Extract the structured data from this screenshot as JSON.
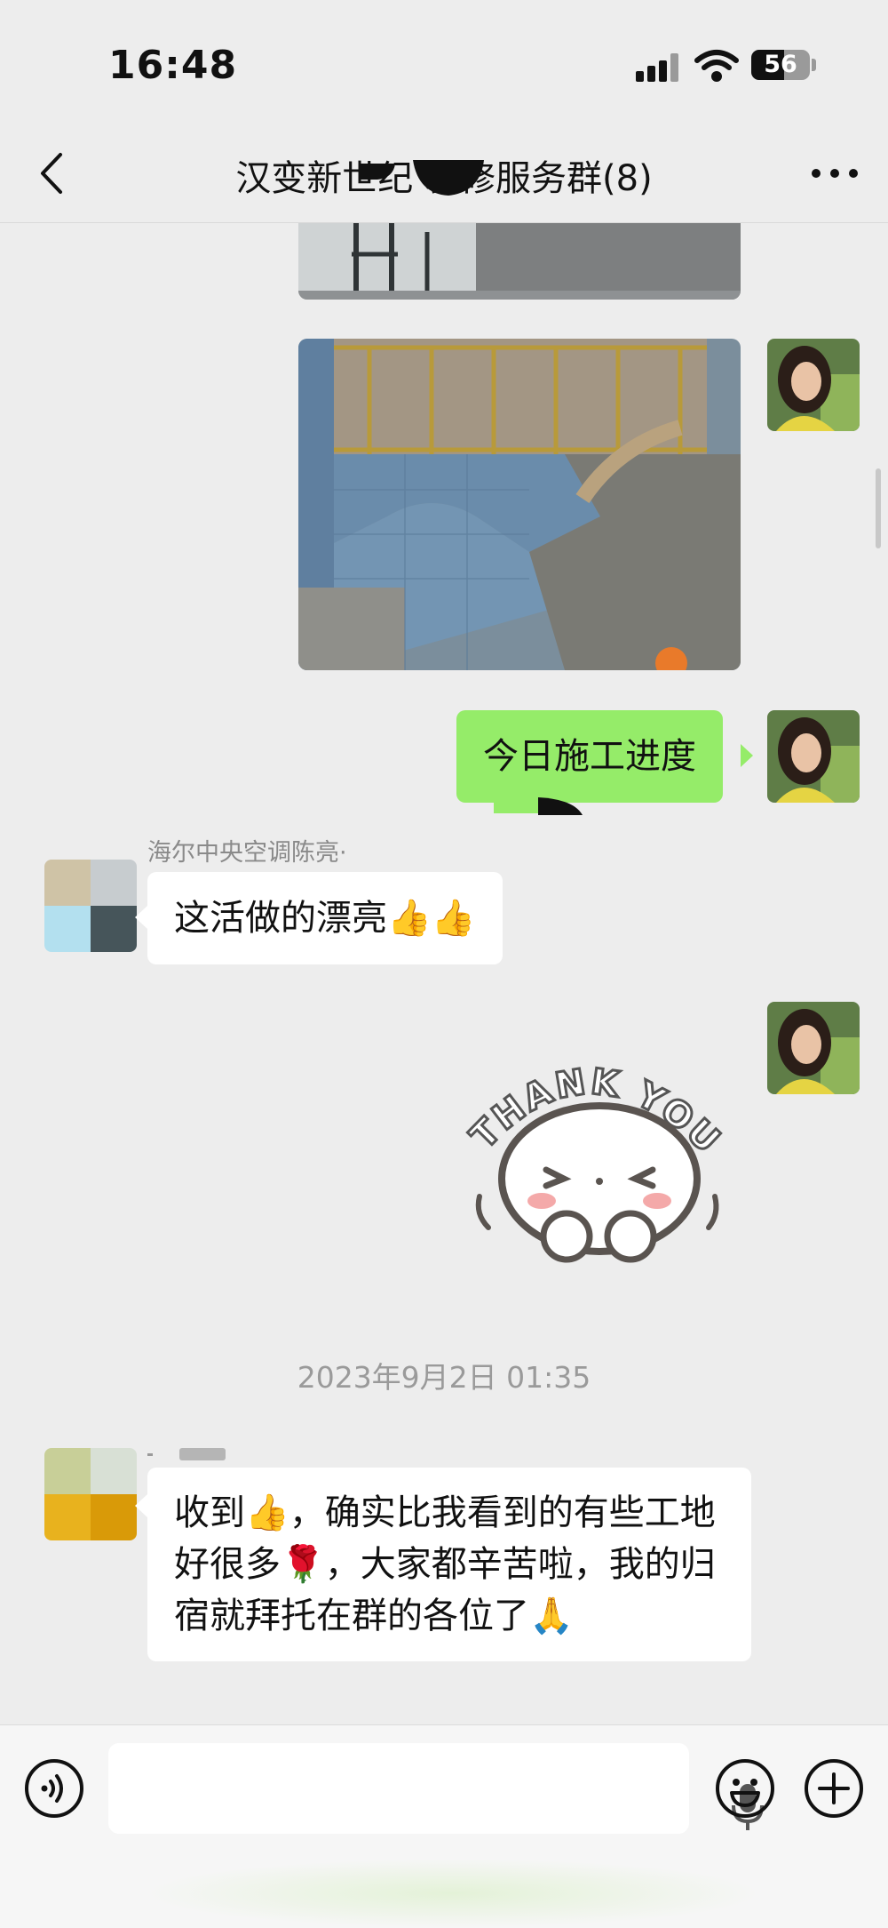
{
  "status_bar": {
    "time": "16:48",
    "battery": "56"
  },
  "nav": {
    "title": "汉变新世纪 装修服务群(8)"
  },
  "messages": {
    "m1_text": "今日施工进度",
    "m2_nickname": "海尔中央空调陈亮·",
    "m2_text": "这活做的漂亮👍👍",
    "sticker_text": "THANK YOU",
    "timestamp": "2023年9月2日 01:35",
    "m4_text": "收到👍，确实比我看到的有些工地好很多🌹，大家都辛苦啦，我的归宿就拜托在群的各位了🙏"
  },
  "colors": {
    "my_bubble": "#95ec69",
    "other_bubble": "#ffffff",
    "background": "#ededed"
  },
  "icons": {
    "back": "chevron-left-icon",
    "more": "more-icon",
    "voice": "voice-icon",
    "mic": "mic-icon",
    "emoji": "emoji-icon",
    "plus": "plus-icon"
  }
}
